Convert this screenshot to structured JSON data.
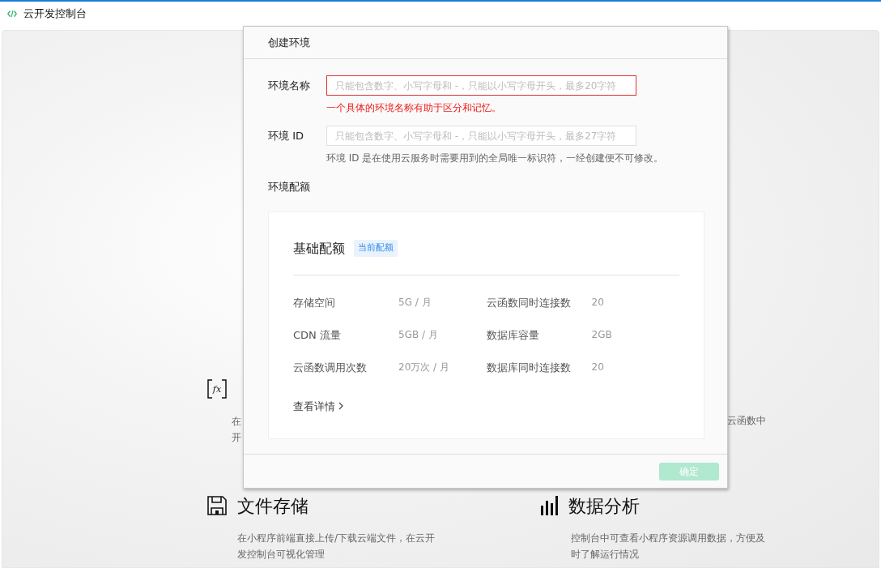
{
  "window": {
    "title": "云开发控制台"
  },
  "features": [
    {
      "kind": "functions",
      "icon_text": "fx",
      "lines": [
        "在",
        "开"
      ]
    },
    {
      "kind": "covered",
      "lines": [
        "云函数中"
      ]
    },
    {
      "kind": "storage",
      "title": "文件存储",
      "lines": [
        "在小程序前端直接上传/下载云端文件，在云开",
        "发控制台可视化管理"
      ]
    },
    {
      "kind": "analytics",
      "title": "数据分析",
      "lines": [
        "控制台中可查看小程序资源调用数据，方便及",
        "时了解运行情况"
      ]
    }
  ],
  "dialog": {
    "title": "创建环境",
    "fields": [
      {
        "label": "环境名称",
        "placeholder": "只能包含数字、小写字母和 -，只能以小写字母开头，最多20字符",
        "invalid": true,
        "hint": "一个具体的环境名称有助于区分和记忆。"
      },
      {
        "label": "环境 ID",
        "placeholder": "只能包含数字、小写字母和 -，只能以小写字母开头，最多27字符",
        "invalid": false,
        "hint": "环境 ID 是在使用云服务时需要用到的全局唯一标识符，一经创建便不可修改。"
      }
    ],
    "quota_label": "环境配额",
    "quota": {
      "title": "基础配额",
      "badge": "当前配额",
      "rows": [
        [
          {
            "name": "存储空间",
            "value": "5G / 月"
          },
          {
            "name": "云函数同时连接数",
            "value": "20"
          }
        ],
        [
          {
            "name": "CDN 流量",
            "value": "5GB / 月"
          },
          {
            "name": "数据库容量",
            "value": "2GB"
          }
        ],
        [
          {
            "name": "云函数调用次数",
            "value": "20万次 / 月"
          },
          {
            "name": "数据库同时连接数",
            "value": "20"
          }
        ]
      ],
      "details_link": "查看详情"
    },
    "confirm": {
      "label": "确定",
      "disabled": true
    }
  }
}
